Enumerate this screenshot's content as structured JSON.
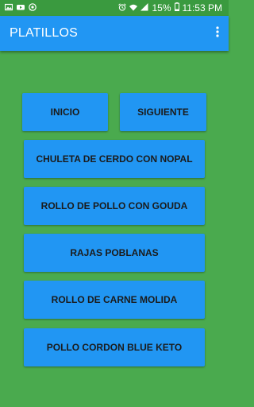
{
  "status_bar": {
    "battery_percent": "15%",
    "time": "11:53 PM",
    "icons": [
      "gallery-icon",
      "youtube-icon",
      "whatsapp-icon",
      "alarm-icon",
      "wifi-icon",
      "signal-icon",
      "battery-icon"
    ]
  },
  "app_bar": {
    "title": "PLATILLOS",
    "menu_icon": "more-vert-icon"
  },
  "nav": {
    "inicio_label": "INICIO",
    "siguiente_label": "SIGUIENTE"
  },
  "dishes": [
    {
      "label": "CHULETA DE CERDO CON NOPAL"
    },
    {
      "label": "ROLLO DE POLLO CON GOUDA"
    },
    {
      "label": "RAJAS POBLANAS"
    },
    {
      "label": "ROLLO DE CARNE MOLIDA"
    },
    {
      "label": "POLLO CORDON BLUE KETO"
    }
  ],
  "colors": {
    "background": "#4aaa4e",
    "status_bar": "#3a9a3f",
    "app_bar": "#2196f3",
    "button": "#2196f3"
  }
}
